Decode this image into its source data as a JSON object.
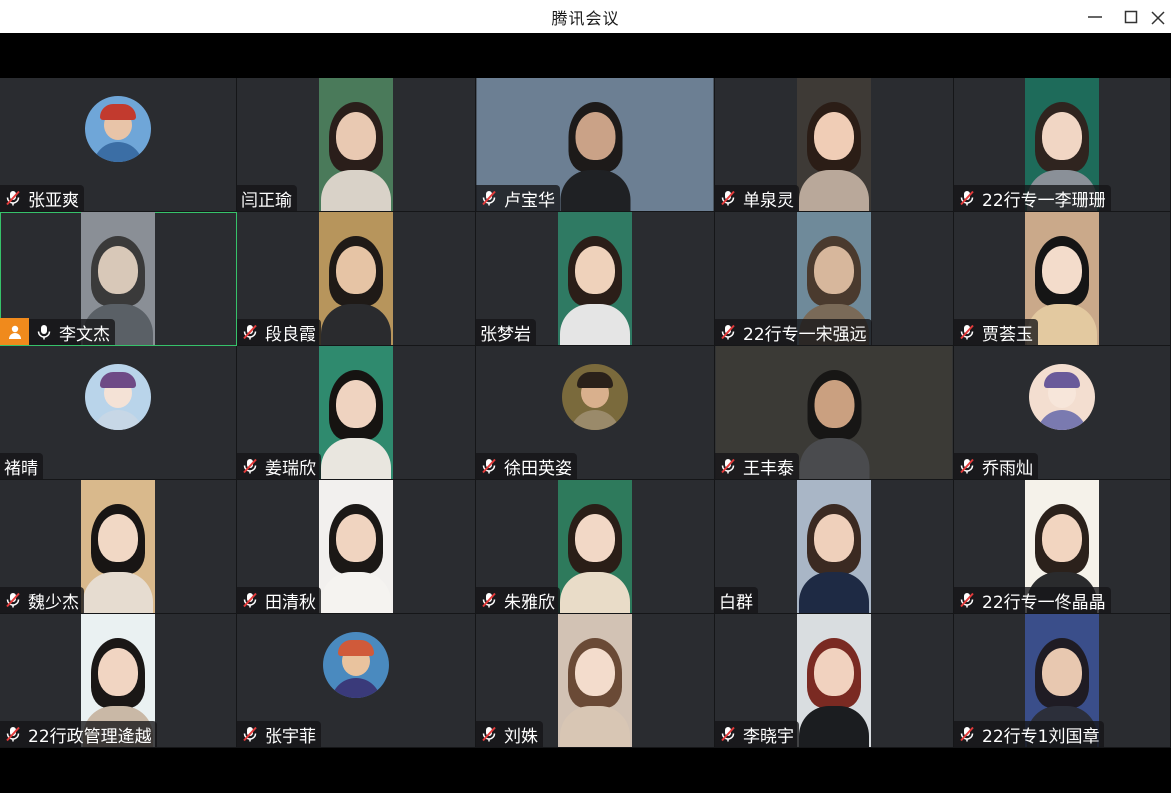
{
  "window": {
    "title": "腾讯会议",
    "minimize_icon": "minimize-icon",
    "maximize_icon": "maximize-icon",
    "close_icon": "close-icon"
  },
  "colors": {
    "tile_bg": "#2a2c30",
    "active_border": "#36c26a",
    "host_badge": "#f08a1c",
    "mute_red": "#e33b3b"
  },
  "participants": [
    {
      "name": "张亚爽",
      "muted": true,
      "kind": "avatar"
    },
    {
      "name": "闫正瑜",
      "muted": null,
      "kind": "video"
    },
    {
      "name": "卢宝华",
      "muted": true,
      "kind": "video-wide"
    },
    {
      "name": "单泉灵",
      "muted": true,
      "kind": "video"
    },
    {
      "name": "22行专一李珊珊",
      "muted": true,
      "kind": "video"
    },
    {
      "name": "李文杰",
      "muted": false,
      "kind": "video",
      "host": true,
      "active": true
    },
    {
      "name": "段良霞",
      "muted": true,
      "kind": "video"
    },
    {
      "name": "张梦岩",
      "muted": null,
      "kind": "video"
    },
    {
      "name": "22行专一宋强远",
      "muted": true,
      "kind": "video"
    },
    {
      "name": "贾荟玉",
      "muted": true,
      "kind": "video"
    },
    {
      "name": "褚晴",
      "muted": null,
      "kind": "avatar"
    },
    {
      "name": "姜瑞欣",
      "muted": true,
      "kind": "video"
    },
    {
      "name": "徐田英姿",
      "muted": true,
      "kind": "avatar"
    },
    {
      "name": "王丰泰",
      "muted": true,
      "kind": "video-wide"
    },
    {
      "name": "乔雨灿",
      "muted": true,
      "kind": "avatar"
    },
    {
      "name": "魏少杰",
      "muted": true,
      "kind": "video"
    },
    {
      "name": "田清秋",
      "muted": true,
      "kind": "video"
    },
    {
      "name": "朱雅欣",
      "muted": true,
      "kind": "video"
    },
    {
      "name": "白群",
      "muted": null,
      "kind": "video"
    },
    {
      "name": "22行专一佟晶晶",
      "muted": true,
      "kind": "video"
    },
    {
      "name": "22行政管理逄越",
      "muted": true,
      "kind": "video"
    },
    {
      "name": "张宇菲",
      "muted": true,
      "kind": "avatar"
    },
    {
      "name": "刘姝",
      "muted": true,
      "kind": "video"
    },
    {
      "name": "李晓宇",
      "muted": true,
      "kind": "video"
    },
    {
      "name": "22行专1刘国章",
      "muted": true,
      "kind": "video"
    }
  ]
}
